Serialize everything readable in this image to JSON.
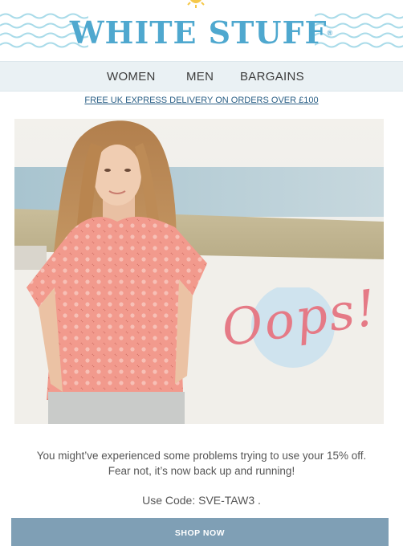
{
  "brand": {
    "logo_text": "WHITE STUFF",
    "registered_mark": "®",
    "accent_color": "#4fa8cf"
  },
  "nav": {
    "items": [
      {
        "label": "WOMEN"
      },
      {
        "label": "MEN"
      },
      {
        "label": "BARGAINS"
      }
    ]
  },
  "promo": {
    "text": "FREE UK EXPRESS DELIVERY ON ORDERS OVER £100"
  },
  "hero": {
    "overlay_text": "Oops!",
    "overlay_color": "#e57a86",
    "circle_color": "#cfe3ee"
  },
  "message": {
    "line1": "You might’ve experienced some problems trying to use your 15% off.",
    "line2": "Fear not, it’s now back up and running!",
    "code_line": "Use Code: SVE-TAW3 ."
  },
  "cta": {
    "label": "SHOP NOW",
    "color": "#7f9fb5"
  }
}
